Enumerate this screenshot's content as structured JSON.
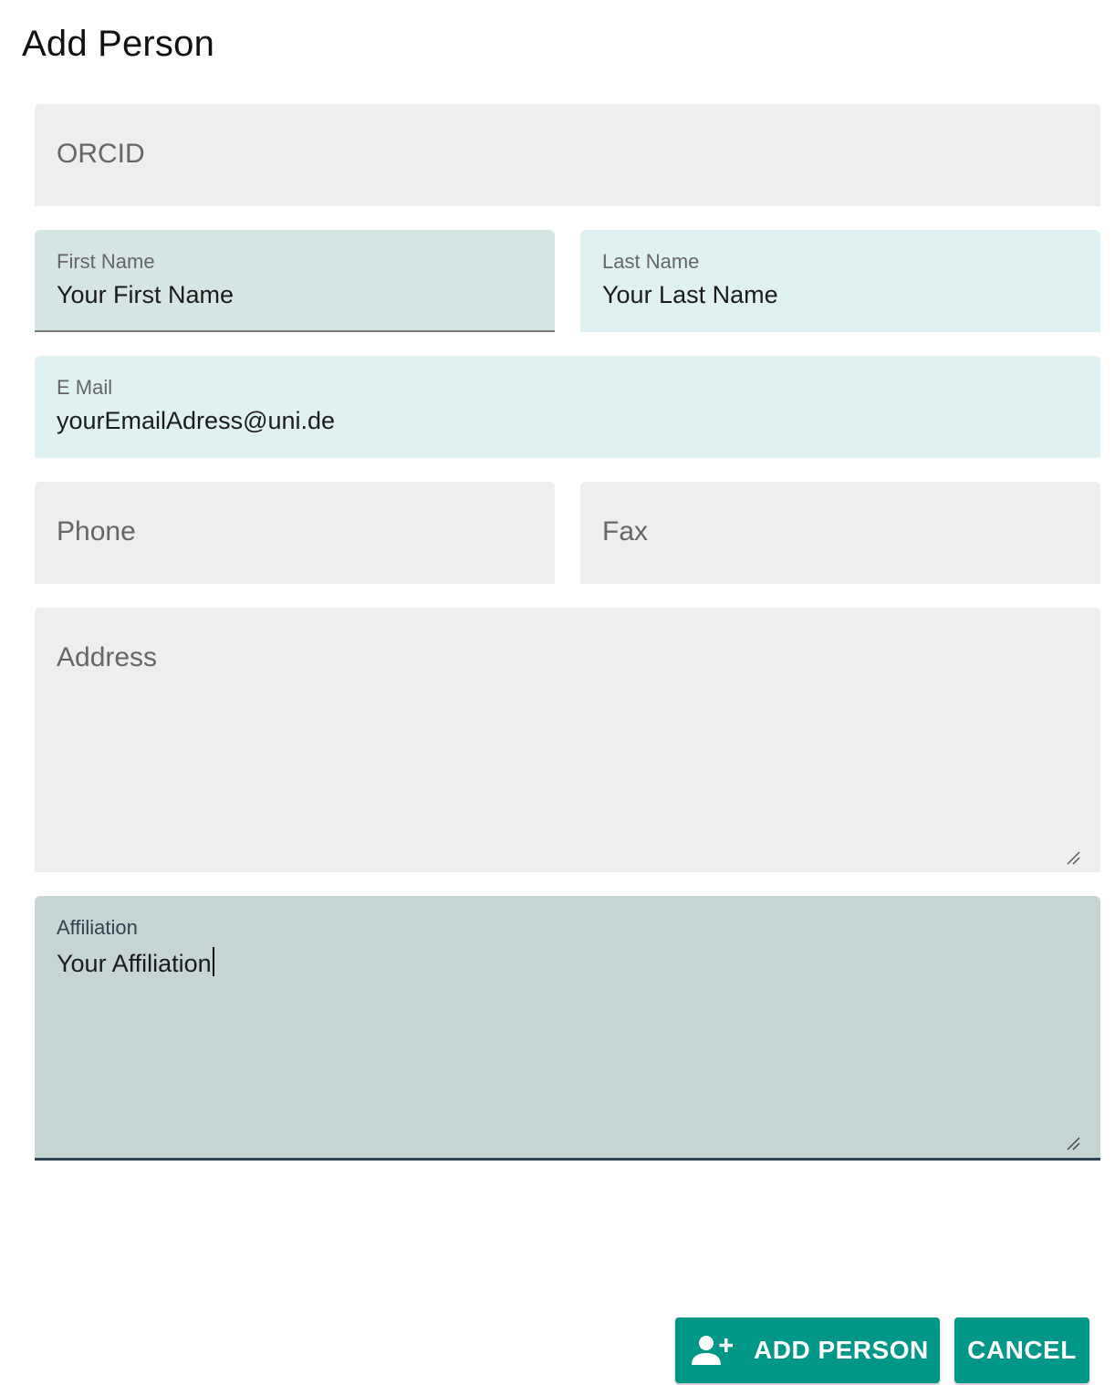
{
  "dialog": {
    "title": "Add Person"
  },
  "form": {
    "orcid": {
      "placeholder": "ORCID"
    },
    "first_name": {
      "label": "First Name",
      "value": "Your First Name"
    },
    "last_name": {
      "label": "Last Name",
      "value": "Your Last Name"
    },
    "email": {
      "label": "E Mail",
      "value": "yourEmailAdress@uni.de"
    },
    "phone": {
      "placeholder": "Phone"
    },
    "fax": {
      "placeholder": "Fax"
    },
    "address": {
      "placeholder": "Address"
    },
    "affiliation": {
      "label": "Affiliation",
      "value": "Your Affiliation"
    }
  },
  "actions": {
    "add_person_label": "ADD PERSON",
    "add_person_icon": "person-add-icon",
    "cancel_label": "CANCEL"
  },
  "colors": {
    "accent": "#009688",
    "field_background": "#eeeeee",
    "field_filled": "#e0f1f1",
    "field_hover": "#d4e5e3",
    "field_focused": "#c4d5d4",
    "focus_underline": "#2f4452"
  }
}
